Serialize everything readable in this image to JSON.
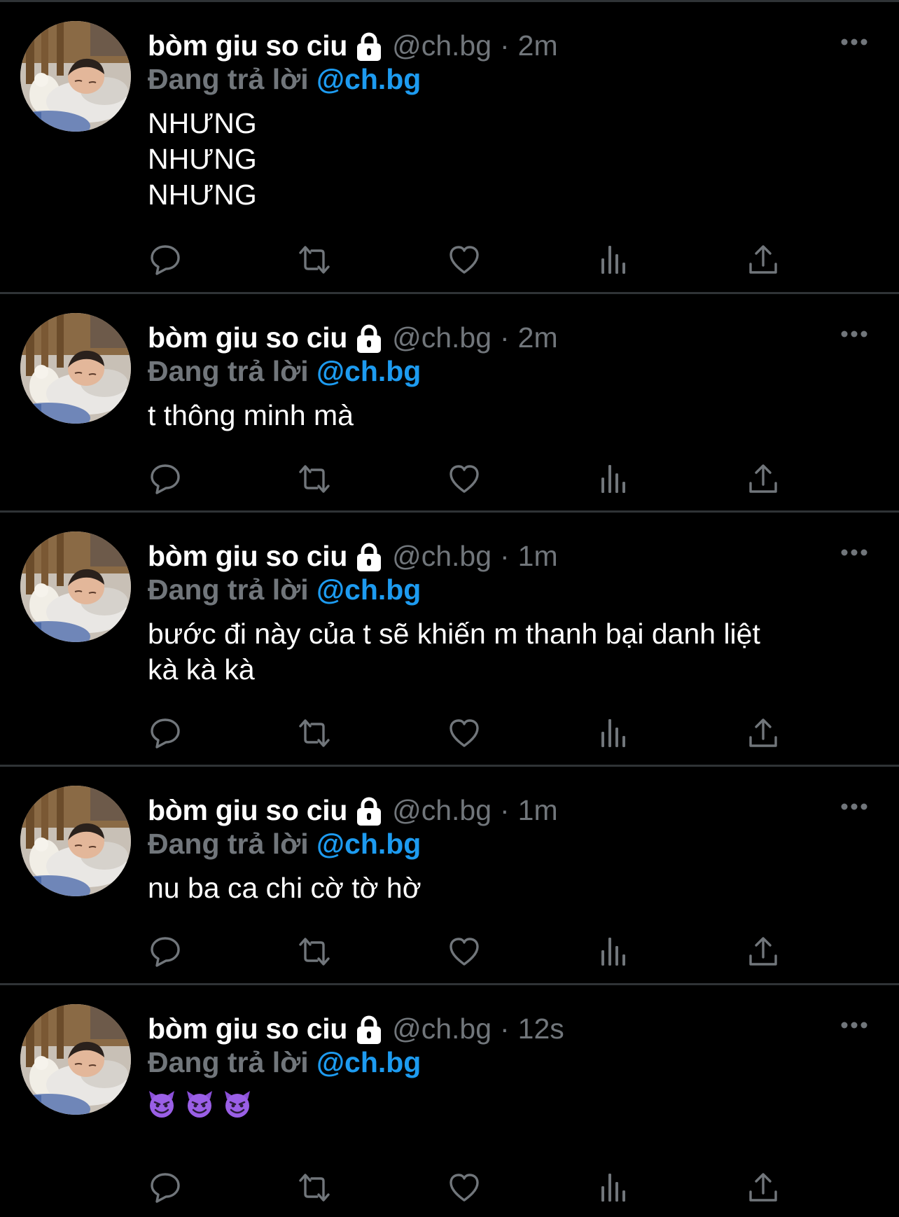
{
  "colors": {
    "background": "#000000",
    "divider": "#2f3336",
    "name": "#ffffff",
    "muted": "#71767b",
    "link": "#1d9bf0"
  },
  "tweets": [
    {
      "display_name": "bòm giu so ciu",
      "handle": "@ch.bg",
      "separator": "·",
      "time": "2m",
      "reply_prefix": "Đang trả lời",
      "reply_to": "@ch.bg",
      "text": "NHƯNG\nNHƯNG\nNHƯNG",
      "emoji_icons": []
    },
    {
      "display_name": "bòm giu so ciu",
      "handle": "@ch.bg",
      "separator": "·",
      "time": "2m",
      "reply_prefix": "Đang trả lời",
      "reply_to": "@ch.bg",
      "text": "t thông minh mà",
      "emoji_icons": []
    },
    {
      "display_name": "bòm giu so ciu",
      "handle": "@ch.bg",
      "separator": "·",
      "time": "1m",
      "reply_prefix": "Đang trả lời",
      "reply_to": "@ch.bg",
      "text": "bước đi này của t sẽ khiến m thanh bại danh liệt\nkà kà kà",
      "emoji_icons": []
    },
    {
      "display_name": "bòm giu so ciu",
      "handle": "@ch.bg",
      "separator": "·",
      "time": "1m",
      "reply_prefix": "Đang trả lời",
      "reply_to": "@ch.bg",
      "text": "nu ba ca chi cờ tờ hờ",
      "emoji_icons": []
    },
    {
      "display_name": "bòm giu so ciu",
      "handle": "@ch.bg",
      "separator": "·",
      "time": "12s",
      "reply_prefix": "Đang trả lời",
      "reply_to": "@ch.bg",
      "text": "",
      "emoji_icons": [
        "smiling-imp-emoji",
        "smiling-imp-emoji",
        "smiling-imp-emoji"
      ]
    }
  ],
  "icons": {
    "lock": "lock-icon",
    "more": "more-options-icon",
    "reply": "reply-icon",
    "retweet": "retweet-icon",
    "like": "like-icon",
    "views": "views-icon",
    "share": "share-icon"
  }
}
